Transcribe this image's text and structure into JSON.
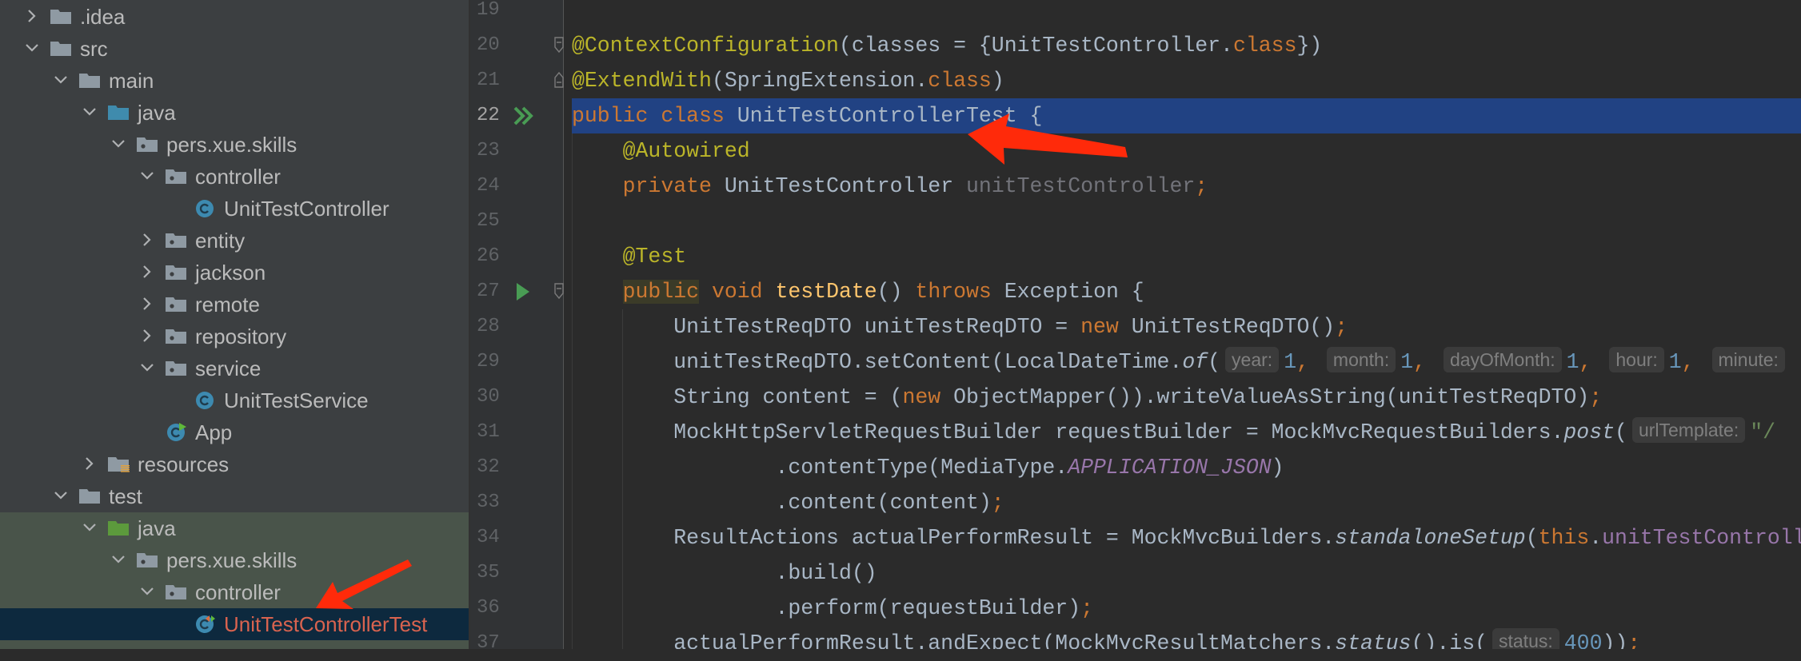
{
  "project_tree": {
    "items": [
      {
        "label": ".idea",
        "depth": 0,
        "chevron": "right",
        "icon": "folder-icon"
      },
      {
        "label": "src",
        "depth": 0,
        "chevron": "down",
        "icon": "folder-icon"
      },
      {
        "label": "main",
        "depth": 1,
        "chevron": "down",
        "icon": "folder-icon"
      },
      {
        "label": "java",
        "depth": 2,
        "chevron": "down",
        "icon": "source-root-folder-icon"
      },
      {
        "label": "pers.xue.skills",
        "depth": 3,
        "chevron": "down",
        "icon": "package-icon"
      },
      {
        "label": "controller",
        "depth": 4,
        "chevron": "down",
        "icon": "package-icon"
      },
      {
        "label": "UnitTestController",
        "depth": 5,
        "chevron": null,
        "icon": "java-class-icon"
      },
      {
        "label": "entity",
        "depth": 4,
        "chevron": "right",
        "icon": "package-icon"
      },
      {
        "label": "jackson",
        "depth": 4,
        "chevron": "right",
        "icon": "package-icon"
      },
      {
        "label": "remote",
        "depth": 4,
        "chevron": "right",
        "icon": "package-icon"
      },
      {
        "label": "repository",
        "depth": 4,
        "chevron": "right",
        "icon": "package-icon"
      },
      {
        "label": "service",
        "depth": 4,
        "chevron": "down",
        "icon": "package-icon"
      },
      {
        "label": "UnitTestService",
        "depth": 5,
        "chevron": null,
        "icon": "java-class-icon"
      },
      {
        "label": "App",
        "depth": 4,
        "chevron": null,
        "icon": "runnable-class-icon"
      },
      {
        "label": "resources",
        "depth": 2,
        "chevron": "right",
        "icon": "resources-folder-icon"
      },
      {
        "label": "test",
        "depth": 1,
        "chevron": "down",
        "icon": "folder-icon"
      },
      {
        "label": "java",
        "depth": 2,
        "chevron": "down",
        "icon": "test-root-folder-icon",
        "test_area": true
      },
      {
        "label": "pers.xue.skills",
        "depth": 3,
        "chevron": "down",
        "icon": "package-icon",
        "test_area": true
      },
      {
        "label": "controller",
        "depth": 4,
        "chevron": "down",
        "icon": "package-icon",
        "test_area": true
      },
      {
        "label": "UnitTestControllerTest",
        "depth": 5,
        "chevron": null,
        "icon": "test-class-icon",
        "selected": true
      },
      {
        "label": "",
        "depth": 4,
        "chevron": "right",
        "icon": "package-icon",
        "test_area": true
      }
    ]
  },
  "colors": {
    "sidebar_bg": "#3c3f41",
    "editor_bg": "#2b2b2b",
    "selection": "#214283",
    "selected_row": "#0d293e",
    "test_area": "#49544a",
    "keyword": "#cc7832",
    "annotation": "#bbb529",
    "method": "#ffc66d",
    "field": "#9876aa",
    "number": "#6897bb",
    "string": "#6a8759",
    "arrow": "#ff2a0a"
  },
  "editor": {
    "current_line": 22,
    "lines": [
      {
        "n": "19",
        "tokens": []
      },
      {
        "n": "20",
        "gutter": "fold-start-icon",
        "tokens": [
          [
            "@ContextConfiguration",
            "ann"
          ],
          [
            "(classes = {UnitTestController.",
            ""
          ],
          [
            "class",
            "kw"
          ],
          [
            "})",
            ""
          ]
        ]
      },
      {
        "n": "21",
        "gutter": "fold-end-icon",
        "tokens": [
          [
            "@ExtendWith",
            "ann"
          ],
          [
            "(SpringExtension.",
            ""
          ],
          [
            "class",
            "kw"
          ],
          [
            ")",
            ""
          ]
        ]
      },
      {
        "n": "22",
        "gutter": "run-all-tests-icon",
        "tokens": [
          [
            "public ",
            "kw"
          ],
          [
            "class ",
            "kw"
          ],
          [
            "UnitTestControllerTest {",
            ""
          ]
        ]
      },
      {
        "n": "23",
        "tokens": [
          [
            "    ",
            ""
          ],
          [
            "@Autowired",
            "ann"
          ]
        ]
      },
      {
        "n": "24",
        "tokens": [
          [
            "    ",
            ""
          ],
          [
            "private ",
            "kw"
          ],
          [
            "UnitTestController ",
            ""
          ],
          [
            "unitTestController",
            "unused"
          ],
          [
            ";",
            "kw"
          ]
        ]
      },
      {
        "n": "25",
        "tokens": []
      },
      {
        "n": "26",
        "tokens": [
          [
            "    ",
            ""
          ],
          [
            "@Test",
            "ann"
          ]
        ]
      },
      {
        "n": "27",
        "gutter": "run-test-icon",
        "tokens": [
          [
            "    ",
            ""
          ],
          [
            "public",
            "kw match"
          ],
          [
            " ",
            ""
          ],
          [
            "void ",
            "kw"
          ],
          [
            "testDate",
            "fn"
          ],
          [
            "() ",
            ""
          ],
          [
            "throws ",
            "kw"
          ],
          [
            "Exception {",
            ""
          ]
        ]
      },
      {
        "n": "28",
        "tokens": [
          [
            "        UnitTestReqDTO unitTestReqDTO = ",
            ""
          ],
          [
            "new ",
            "kw"
          ],
          [
            "UnitTestReqDTO()",
            ""
          ],
          [
            ";",
            "kw"
          ]
        ]
      },
      {
        "n": "29",
        "tokens": [
          [
            "        unitTestReqDTO.setContent(LocalDateTime.",
            ""
          ],
          [
            "of",
            "st"
          ],
          [
            "(",
            ""
          ],
          [
            "year:",
            "hint"
          ],
          [
            "1",
            "num"
          ],
          [
            ", ",
            "kw"
          ],
          [
            "month:",
            "hint"
          ],
          [
            "1",
            "num"
          ],
          [
            ", ",
            "kw"
          ],
          [
            "dayOfMonth:",
            "hint"
          ],
          [
            "1",
            "num"
          ],
          [
            ", ",
            "kw"
          ],
          [
            "hour:",
            "hint"
          ],
          [
            "1",
            "num"
          ],
          [
            ", ",
            "kw"
          ],
          [
            "minute:",
            "hint"
          ]
        ]
      },
      {
        "n": "30",
        "tokens": [
          [
            "        String content = (",
            ""
          ],
          [
            "new ",
            "kw"
          ],
          [
            "ObjectMapper()).writeValueAsString(unitTestReqDTO)",
            ""
          ],
          [
            ";",
            "kw"
          ]
        ]
      },
      {
        "n": "31",
        "tokens": [
          [
            "        MockHttpServletRequestBuilder requestBuilder = MockMvcRequestBuilders.",
            ""
          ],
          [
            "post",
            "st"
          ],
          [
            "(",
            ""
          ],
          [
            "urlTemplate:",
            "hint"
          ],
          [
            "\"/",
            "str"
          ]
        ]
      },
      {
        "n": "32",
        "tokens": [
          [
            "                .contentType(MediaType.",
            ""
          ],
          [
            "APPLICATION_JSON",
            "cst"
          ],
          [
            ")",
            ""
          ]
        ]
      },
      {
        "n": "33",
        "tokens": [
          [
            "                .content(content)",
            ""
          ],
          [
            ";",
            "kw"
          ]
        ]
      },
      {
        "n": "34",
        "tokens": [
          [
            "        ResultActions actualPerformResult = MockMvcBuilders.",
            ""
          ],
          [
            "standaloneSetup",
            "st"
          ],
          [
            "(",
            ""
          ],
          [
            "this",
            "kw"
          ],
          [
            ".",
            ""
          ],
          [
            "unitTestController",
            "fld"
          ]
        ]
      },
      {
        "n": "35",
        "tokens": [
          [
            "                .build()",
            ""
          ]
        ]
      },
      {
        "n": "36",
        "tokens": [
          [
            "                .perform(requestBuilder)",
            ""
          ],
          [
            ";",
            "kw"
          ]
        ]
      },
      {
        "n": "37",
        "tokens": [
          [
            "        actualPerformResult.andExpect(MockMvcResultMatchers.",
            ""
          ],
          [
            "status",
            "st"
          ],
          [
            "().is(",
            ""
          ],
          [
            "status:",
            "hint"
          ],
          [
            "400",
            "num"
          ],
          [
            "))",
            ""
          ],
          [
            ";",
            "kw"
          ]
        ]
      }
    ]
  },
  "annotations": [
    {
      "icon": "red-arrow-icon",
      "points_to": "public class UnitTestControllerTest"
    },
    {
      "icon": "red-arrow-icon",
      "points_to": "UnitTestControllerTest"
    }
  ]
}
